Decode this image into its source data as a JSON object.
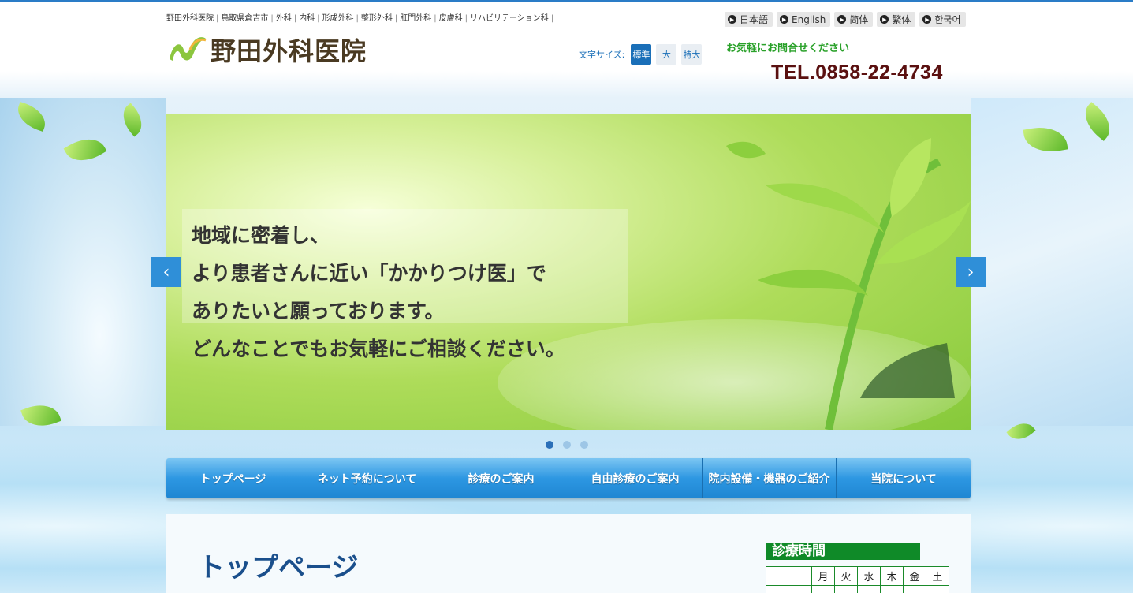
{
  "header": {
    "breadcrumb": [
      "野田外科医院",
      "鳥取県倉吉市",
      "外科",
      "内科",
      "形成外科",
      "整形外科",
      "肛門外科",
      "皮膚科",
      "リハビリテーション科"
    ],
    "logo_text": "野田外科医院",
    "font_size": {
      "label": "文字サイズ:",
      "options": [
        "標準",
        "大",
        "特大"
      ],
      "selected": "標準"
    },
    "languages": [
      "日本語",
      "English",
      "简体",
      "繁体",
      "한국어"
    ],
    "contact_note": "お気軽にお問合せください",
    "tel": "TEL.0858-22-4734"
  },
  "slider": {
    "caption_lines": [
      "地域に密着し、",
      "より患者さんに近い「かかりつけ医」で",
      "ありたいと願っております。",
      "どんなことでもお気軽にご相談ください。"
    ],
    "prev": "‹",
    "next": "›",
    "slide_count": 3,
    "active_slide": 1
  },
  "nav": {
    "items": [
      "トップページ",
      "ネット予約について",
      "診療のご案内",
      "自由診療のご案内",
      "院内設備・機器のご紹介",
      "当院について"
    ]
  },
  "main": {
    "page_title": "トップページ"
  },
  "hours": {
    "title": "診療時間",
    "days": [
      "",
      "月",
      "火",
      "水",
      "木",
      "金",
      "土"
    ]
  },
  "colors": {
    "accent_blue": "#2a7cc7",
    "nav_blue": "#2d97e2",
    "hours_green": "#0f8a28",
    "tel_color": "#5a1010",
    "note_green": "#2aa12a"
  }
}
